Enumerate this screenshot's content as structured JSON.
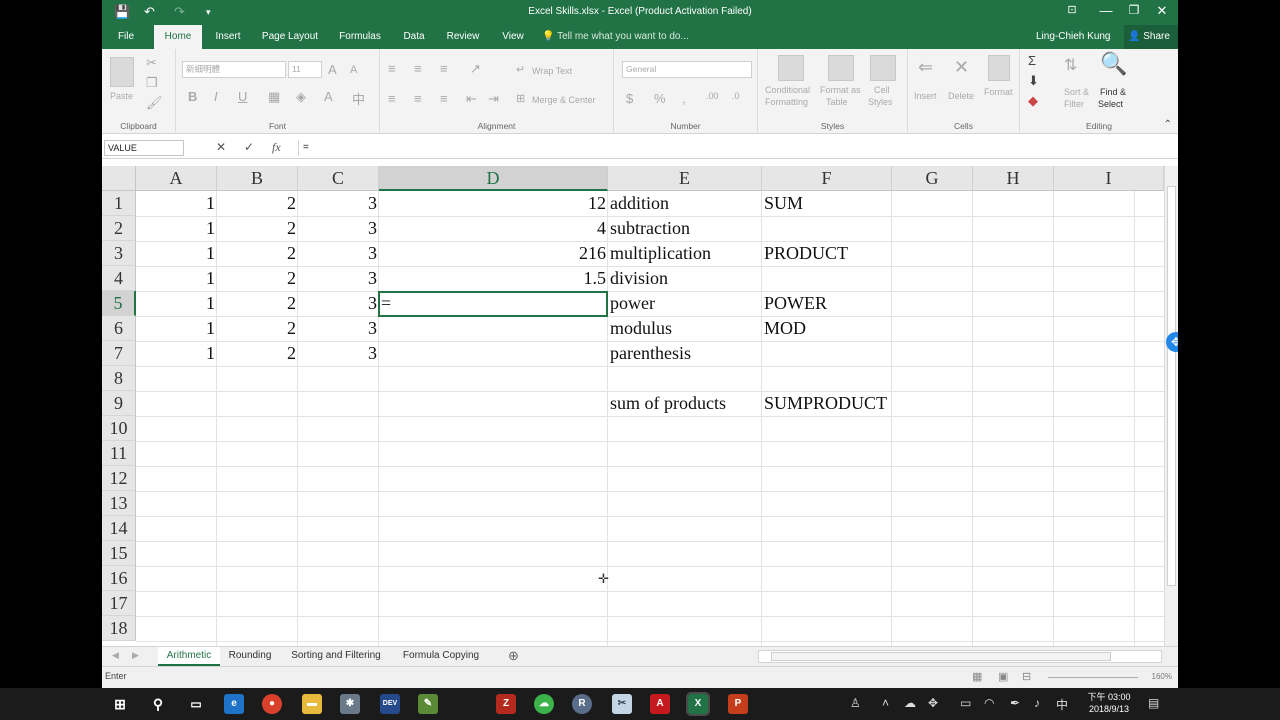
{
  "window": {
    "title": "Excel Skills.xlsx - Excel (Product Activation Failed)"
  },
  "ribbon_tabs": [
    "File",
    "Home",
    "Insert",
    "Page Layout",
    "Formulas",
    "Data",
    "Review",
    "View"
  ],
  "active_tab": "Home",
  "tell_me": "Tell me what you want to do...",
  "user_name": "Ling-Chieh Kung",
  "share_label": "Share",
  "ribbon": {
    "clipboard": {
      "label": "Clipboard",
      "paste": "Paste"
    },
    "font": {
      "label": "Font",
      "name": "新細明體",
      "size": "11"
    },
    "alignment": {
      "label": "Alignment",
      "wrap_text": "Wrap Text",
      "merge_center": "Merge & Center"
    },
    "number": {
      "label": "Number",
      "format": "General"
    },
    "styles": {
      "label": "Styles",
      "conditional": "Conditional",
      "conditional2": "Formatting",
      "format_as": "Format as",
      "format_as2": "Table",
      "cell_styles": "Cell",
      "cell_styles2": "Styles"
    },
    "cells": {
      "label": "Cells",
      "insert": "Insert",
      "delete": "Delete",
      "format": "Format"
    },
    "editing": {
      "label": "Editing",
      "sort": "Sort &",
      "sort2": "Filter",
      "find": "Find &",
      "find2": "Select"
    }
  },
  "formula_bar": {
    "name_box": "VALUE",
    "cancel": "✕",
    "enter": "✓",
    "fx": "fx",
    "formula": "="
  },
  "columns": [
    "A",
    "B",
    "C",
    "D",
    "E",
    "F",
    "G",
    "H",
    "I"
  ],
  "rows": [
    "1",
    "2",
    "3",
    "4",
    "5",
    "6",
    "7",
    "8",
    "9",
    "10",
    "11",
    "12",
    "13",
    "14",
    "15",
    "16",
    "17",
    "18"
  ],
  "cells": {
    "A1": "1",
    "B1": "2",
    "C1": "3",
    "D1": "12",
    "E1": "addition",
    "F1": "SUM",
    "A2": "1",
    "B2": "2",
    "C2": "3",
    "D2": "4",
    "E2": "subtraction",
    "A3": "1",
    "B3": "2",
    "C3": "3",
    "D3": "216",
    "E3": "multiplication",
    "F3": "PRODUCT",
    "A4": "1",
    "B4": "2",
    "C4": "3",
    "D4": "1.5",
    "E4": "division",
    "A5": "1",
    "B5": "2",
    "C5": "3",
    "D5": "=",
    "E5": "power",
    "F5": "POWER",
    "A6": "1",
    "B6": "2",
    "C6": "3",
    "E6": "modulus",
    "F6": "MOD",
    "A7": "1",
    "B7": "2",
    "C7": "3",
    "E7": "parenthesis",
    "E9": "sum of products",
    "F9": "SUMPRODUCT"
  },
  "active_cell": "D5",
  "sheets": [
    "Arithmetic",
    "Rounding",
    "Sorting and Filtering",
    "Formula Copying"
  ],
  "active_sheet": "Arithmetic",
  "status": {
    "mode": "Enter",
    "zoom": "160%"
  },
  "taskbar": {
    "time": "下午 03:00",
    "date": "2018/9/13"
  }
}
